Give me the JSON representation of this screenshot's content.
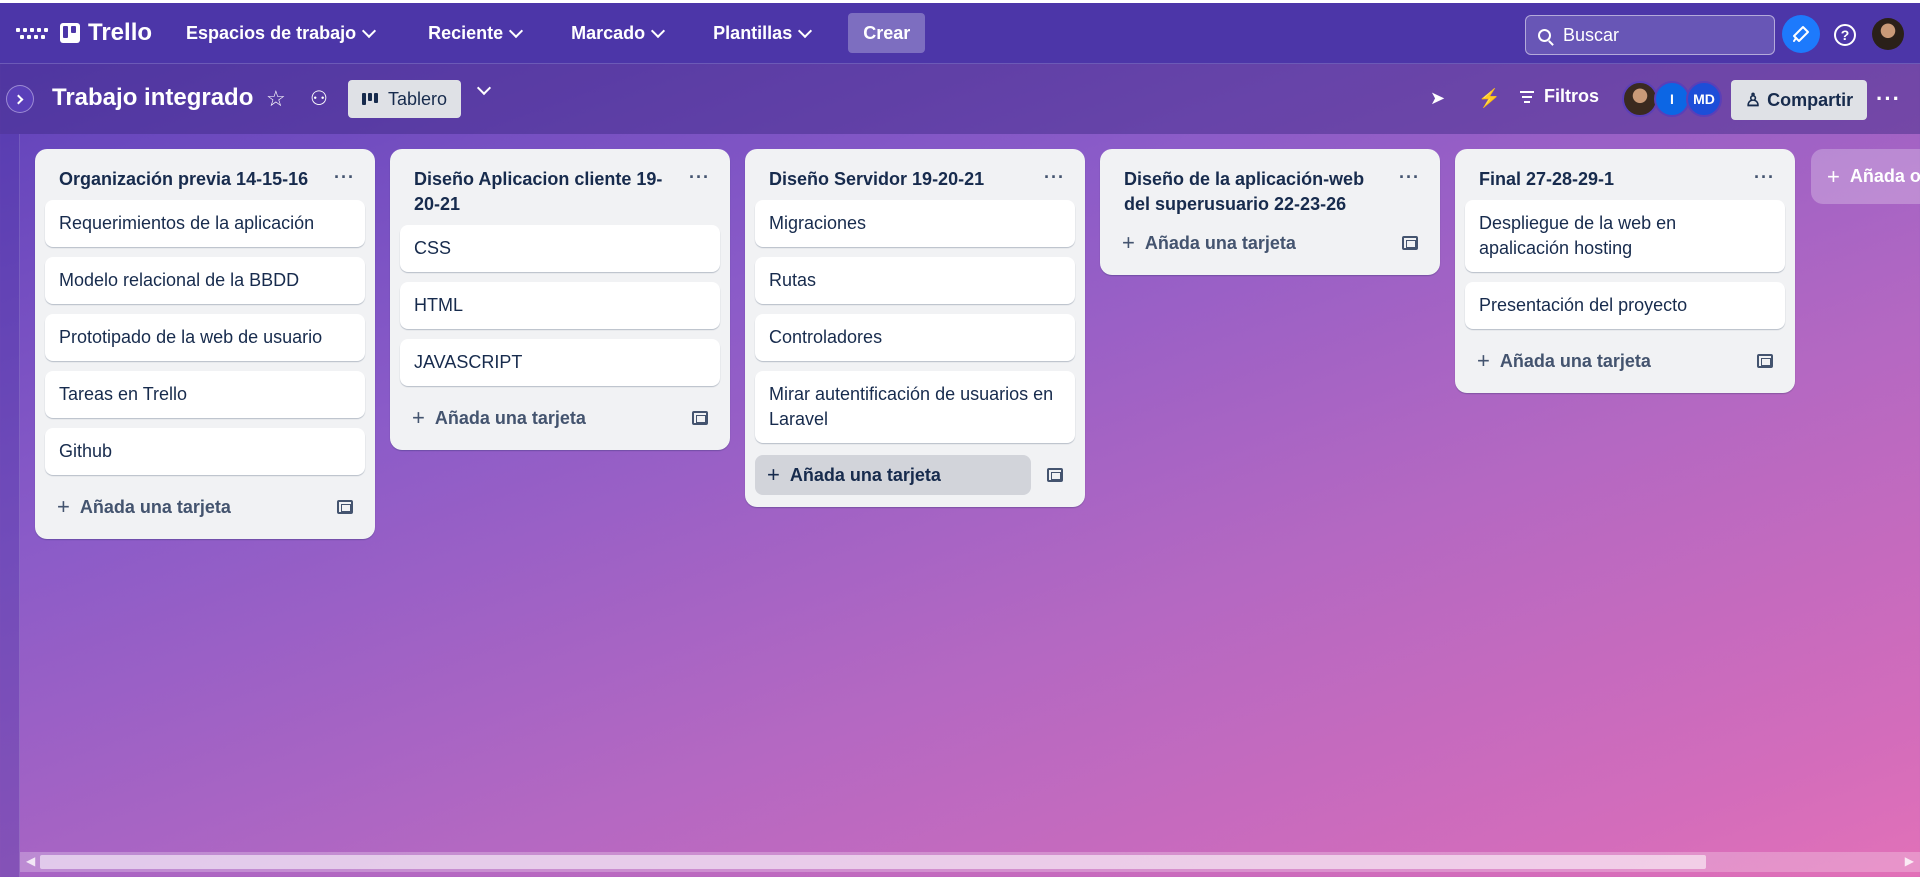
{
  "topbar": {
    "logo_text": "Trello",
    "nav": [
      {
        "label": "Espacios de trabajo"
      },
      {
        "label": "Reciente"
      },
      {
        "label": "Marcado"
      },
      {
        "label": "Plantillas"
      }
    ],
    "create_label": "Crear",
    "search_placeholder": "Buscar",
    "colors": {
      "bar": "#4c36a8",
      "notify": "#1d7afc"
    }
  },
  "board": {
    "title": "Trabajo integrado",
    "view_label": "Tablero",
    "filters_label": "Filtros",
    "share_label": "Compartir",
    "members": [
      {
        "initials": ""
      },
      {
        "initials": "I"
      },
      {
        "initials": "MD"
      }
    ]
  },
  "lists": [
    {
      "title": "Organización previa 14-15-16",
      "cards": [
        "Requerimientos de la aplicación",
        "Modelo relacional de la BBDD",
        "Prototipado de la web de usuario",
        "Tareas en Trello",
        "Github"
      ],
      "add_label": "Añada una tarjeta"
    },
    {
      "title": "Diseño Aplicacion cliente 19-20-21",
      "cards": [
        "CSS",
        "HTML",
        "JAVASCRIPT"
      ],
      "add_label": "Añada una tarjeta"
    },
    {
      "title": "Diseño Servidor 19-20-21",
      "cards": [
        "Migraciones",
        "Rutas",
        "Controladores",
        "Mirar autentificación de usuarios en Laravel"
      ],
      "add_label": "Añada una tarjeta"
    },
    {
      "title": "Diseño de la aplicación-web del superusuario 22-23-26",
      "cards": [],
      "add_label": "Añada una tarjeta"
    },
    {
      "title": "Final 27-28-29-1",
      "cards": [
        "Despliegue de la web en apalicación hosting",
        "Presentación del proyecto"
      ],
      "add_label": "Añada una tarjeta"
    }
  ],
  "add_list_label": "Añada o"
}
